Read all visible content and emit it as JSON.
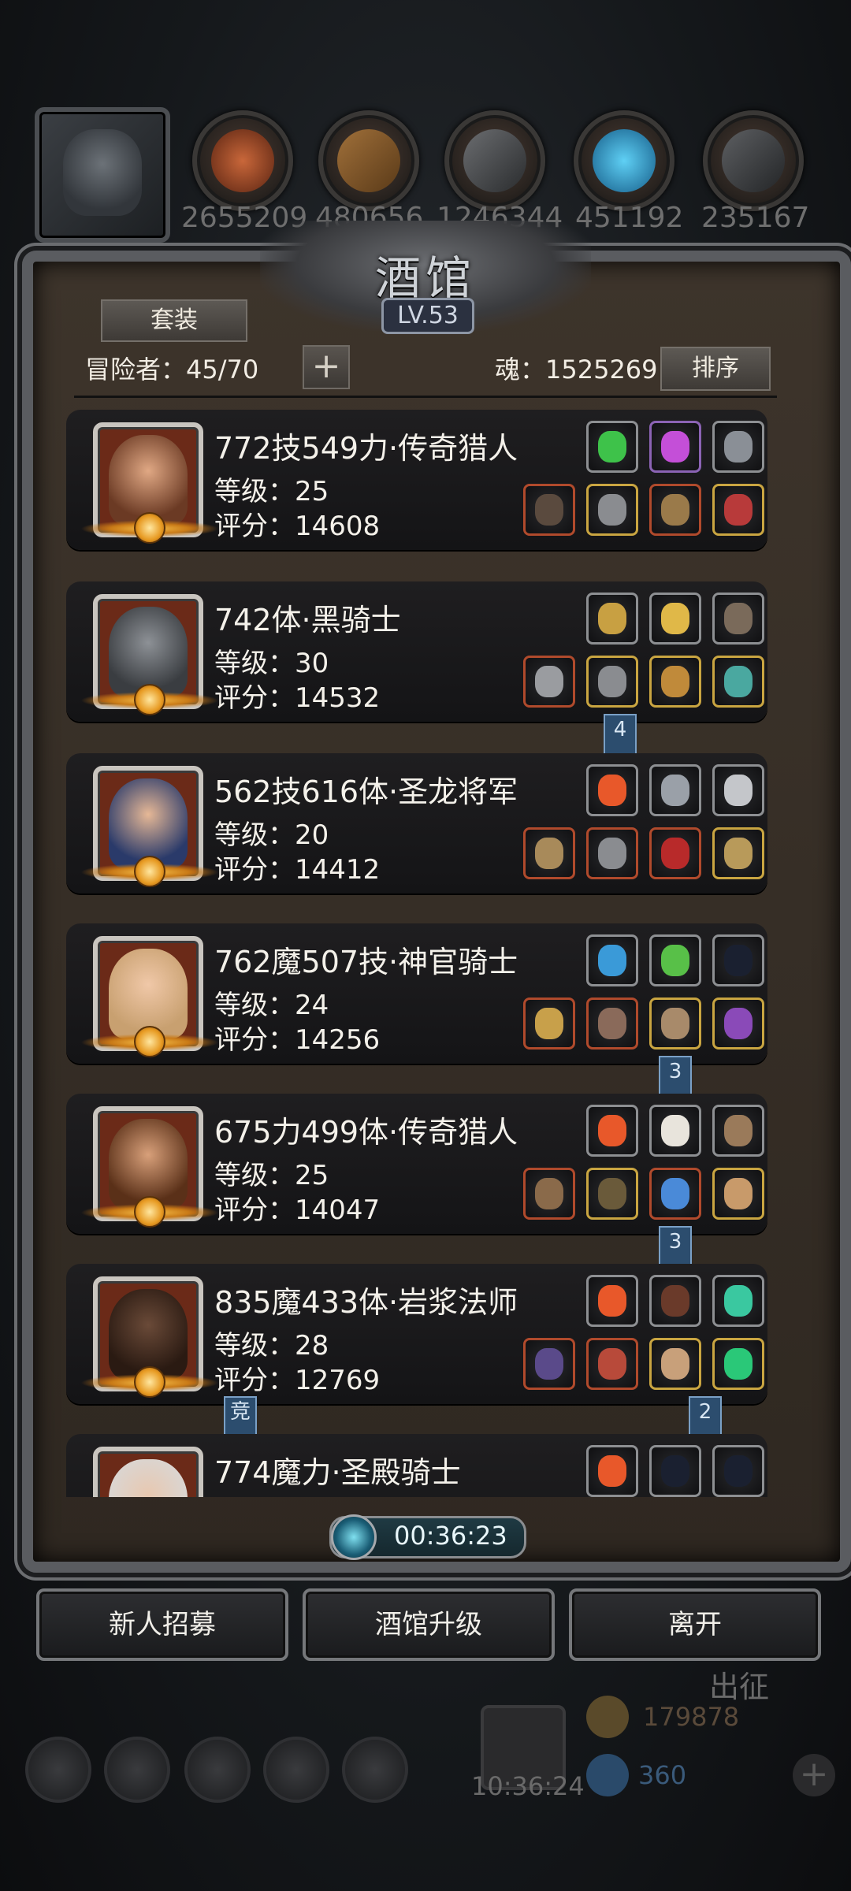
{
  "resources": [
    {
      "icon": "meat-icon",
      "value": "2655209"
    },
    {
      "icon": "wood-icon",
      "value": "480656"
    },
    {
      "icon": "iron-icon",
      "value": "1246344"
    },
    {
      "icon": "crystal-icon",
      "value": "451192"
    },
    {
      "icon": "stone-icon",
      "value": "235167"
    }
  ],
  "tavern": {
    "title": "酒馆",
    "level": "LV.53",
    "set_button": "套装",
    "adventurers_label": "冒险者：45/70",
    "soul_label": "魂：1525269",
    "sort_button": "排序"
  },
  "heroes": [
    {
      "name": "772技549力·传奇猎人",
      "level": "等级：25",
      "score": "评分：14608"
    },
    {
      "name": "742体·黑骑士",
      "level": "等级：30",
      "score": "评分：14532"
    },
    {
      "name": "562技616体·圣龙将军",
      "level": "等级：20",
      "score": "评分：14412"
    },
    {
      "name": "762魔507技·神官骑士",
      "level": "等级：24",
      "score": "评分：14256"
    },
    {
      "name": "675力499体·传奇猎人",
      "level": "等级：25",
      "score": "评分：14047"
    },
    {
      "name": "835魔433体·岩浆法师",
      "level": "等级：28",
      "score": "评分：12769"
    },
    {
      "name": "774魔力·圣殿骑士",
      "level": "",
      "score": ""
    }
  ],
  "tags": [
    "4",
    "3",
    "3",
    "竞",
    "2"
  ],
  "timer": "00:36:23",
  "buttons": {
    "recruit": "新人招募",
    "upgrade": "酒馆升级",
    "leave": "离开"
  },
  "background": {
    "dispatch": "出征",
    "gold": "179878",
    "gems": "360",
    "clock": "10:36:24"
  }
}
